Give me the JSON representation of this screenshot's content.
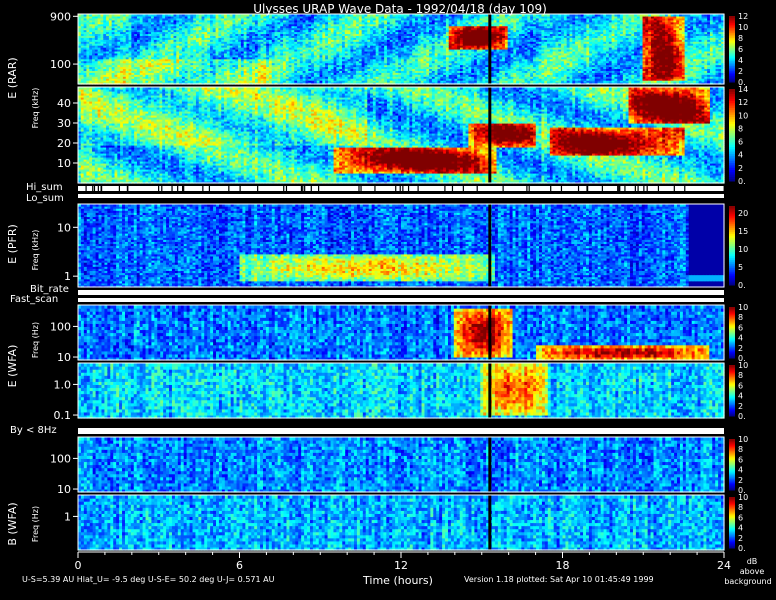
{
  "title": "Ulysses URAP Wave Data - 1992/04/18  (day 109)",
  "footer": {
    "ephemeris": "U-S=5.39 AU   Hlat_U= -9.5 deg   U-S-E= 50.2 deg   U-J= 0.571 AU",
    "version": "Version 1.18 plotted: Sat Apr 10 01:45:49 1999",
    "db_note_1": "dB",
    "db_note_2": "above",
    "db_note_3": "background"
  },
  "labels": {
    "rar_side": "E (RAR)",
    "rar_freq": "Freq (kHz)",
    "hi_sum": "Hi_sum",
    "lo_sum": "Lo_sum",
    "pfr_side": "E (PFR)",
    "pfr_freq": "Freq (kHz)",
    "bit_rate": "Bit_rate",
    "fast_scan": "Fast_scan",
    "wfae_side": "E (WFA)",
    "wfae_freq": "Freq (Hz)",
    "by_label": "By < 8Hz",
    "wfab_side": "B (WFA)",
    "wfab_freq": "Freq (Hz)"
  },
  "chart_data": {
    "type": "heatmap",
    "title": "Ulysses URAP Wave Data - 1992/04/18  (day 109)",
    "xlabel": "Time (hours)",
    "xlim": [
      0,
      24
    ],
    "xticks": [
      "0",
      "6",
      "12",
      "18",
      "24"
    ],
    "colorbar_unit": "dB above background",
    "panels": [
      {
        "id": "rar_hi",
        "yscale": "log",
        "ylim": [
          40,
          1000
        ],
        "yticks": [
          "100",
          "900"
        ],
        "cbar_max": 12,
        "cbar_ticks": [
          "0.",
          "2",
          "4",
          "6",
          "8",
          "10",
          "12"
        ]
      },
      {
        "id": "rar_lo",
        "yscale": "linear",
        "ylim": [
          0,
          48
        ],
        "yticks": [
          "10",
          "20",
          "30",
          "40"
        ],
        "cbar_max": 14,
        "cbar_ticks": [
          "0.",
          "2",
          "4",
          "6",
          "8",
          "10",
          "12",
          "14"
        ]
      },
      {
        "id": "pfr",
        "yscale": "log",
        "ylim": [
          0.6,
          30
        ],
        "yticks": [
          "1",
          "10"
        ],
        "cbar_max": 22,
        "cbar_ticks": [
          "0.",
          "5",
          "10",
          "15",
          "20"
        ]
      },
      {
        "id": "wfa_e_hi",
        "yscale": "log",
        "ylim": [
          8,
          500
        ],
        "yticks": [
          "10",
          "100"
        ],
        "cbar_max": 10,
        "cbar_ticks": [
          "0.",
          "2",
          "4",
          "6",
          "8",
          "10"
        ]
      },
      {
        "id": "wfa_e_lo",
        "yscale": "log",
        "ylim": [
          0.08,
          5
        ],
        "yticks": [
          "0.1",
          "1.0"
        ],
        "cbar_max": 10,
        "cbar_ticks": [
          "0.",
          "2",
          "4",
          "6",
          "8",
          "10"
        ]
      },
      {
        "id": "wfa_b_hi",
        "yscale": "log",
        "ylim": [
          8,
          500
        ],
        "yticks": [
          "10",
          "100"
        ],
        "cbar_max": 10,
        "cbar_ticks": [
          "0.",
          "2",
          "4",
          "6",
          "8",
          "10"
        ]
      },
      {
        "id": "wfa_b_lo",
        "yscale": "log",
        "ylim": [
          0.08,
          5
        ],
        "yticks": [
          "1"
        ],
        "cbar_max": 10,
        "cbar_ticks": [
          "0.",
          "2",
          "4",
          "6",
          "8",
          "10"
        ]
      }
    ],
    "features": [
      {
        "panel": "rar_lo",
        "t_start": 9.5,
        "t_end": 15.5,
        "f_low": 5,
        "f_high": 18,
        "level": "high"
      },
      {
        "panel": "rar_lo",
        "t_start": 14.5,
        "t_end": 17.0,
        "f_low": 18,
        "f_high": 30,
        "level": "high"
      },
      {
        "panel": "rar_lo",
        "t_start": 17.5,
        "t_end": 22.5,
        "f_low": 14,
        "f_high": 28,
        "level": "high"
      },
      {
        "panel": "rar_lo",
        "t_start": 20.5,
        "t_end": 23.5,
        "f_low": 30,
        "f_high": 48,
        "level": "high"
      },
      {
        "panel": "rar_hi",
        "t_start": 13.8,
        "t_end": 16.0,
        "f_low": 200,
        "f_high": 600,
        "level": "high"
      },
      {
        "panel": "rar_hi",
        "t_start": 21.0,
        "t_end": 22.5,
        "f_low": 50,
        "f_high": 900,
        "level": "high"
      },
      {
        "panel": "pfr",
        "t_start": 6.0,
        "t_end": 15.5,
        "f_low": 0.8,
        "f_high": 3,
        "level": "medium"
      },
      {
        "panel": "wfa_e_hi",
        "t_start": 14.0,
        "t_end": 16.2,
        "f_low": 10,
        "f_high": 400,
        "level": "high"
      },
      {
        "panel": "wfa_e_hi",
        "t_start": 17.0,
        "t_end": 23.5,
        "f_low": 8,
        "f_high": 25,
        "level": "high"
      },
      {
        "panel": "wfa_e_lo",
        "t_start": 15.0,
        "t_end": 17.5,
        "f_low": 0.1,
        "f_high": 5,
        "level": "medium"
      }
    ]
  }
}
